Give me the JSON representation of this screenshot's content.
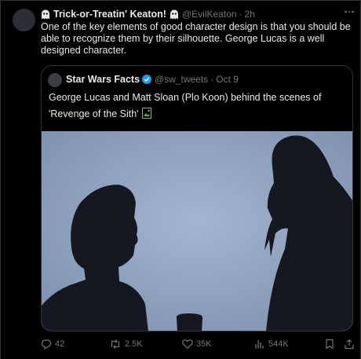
{
  "tweet": {
    "display_name": "Trick-or-Treatin' Keaton!",
    "handle": "@EvilKeaton",
    "separator": "·",
    "time": "2h",
    "text": "One of the key elements of good character design is that you should be able to recognize them by their silhouette. George Lucas is a well designed character."
  },
  "quote": {
    "display_name": "Star Wars Facts",
    "handle": "@sw_tweets",
    "separator": "·",
    "time": "Oct 9",
    "text": "George Lucas and Matt Sloan (Plo Koon) behind the scenes of 'Revenge of the Sith'"
  },
  "actions": {
    "replies": "42",
    "reposts": "2.5K",
    "likes": "35K",
    "views": "544K"
  },
  "colors": {
    "background": "#000000",
    "text": "#e7e9ea",
    "muted": "#71767b",
    "border": "#2f3336",
    "verified": "#1d9bf0",
    "photo_sky": "#8fa1bd",
    "silhouette": "#161821"
  },
  "icons": [
    "ghost-icon",
    "more-icon",
    "verified-icon",
    "broken-image-icon",
    "reply-icon",
    "repost-icon",
    "like-icon",
    "views-icon",
    "bookmark-icon",
    "share-icon"
  ]
}
